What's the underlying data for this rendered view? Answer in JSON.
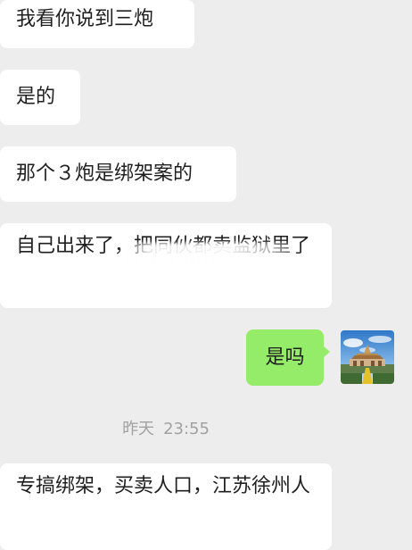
{
  "messages": [
    {
      "side": "incoming",
      "text": "我看你说到三炮"
    },
    {
      "side": "incoming",
      "text": "是的"
    },
    {
      "side": "incoming",
      "text": "那个３炮是绑架案的"
    },
    {
      "side": "incoming",
      "text": "自己出来了，把同伙都卖监狱里了"
    },
    {
      "side": "outgoing",
      "text": "是吗"
    },
    {
      "side": "incoming",
      "text": "专搞绑架，买卖人口，江苏徐州人"
    }
  ],
  "timestamp": {
    "day": "昨天",
    "time": "23:55"
  },
  "avatar": {
    "icon": "temple-photo-avatar"
  }
}
